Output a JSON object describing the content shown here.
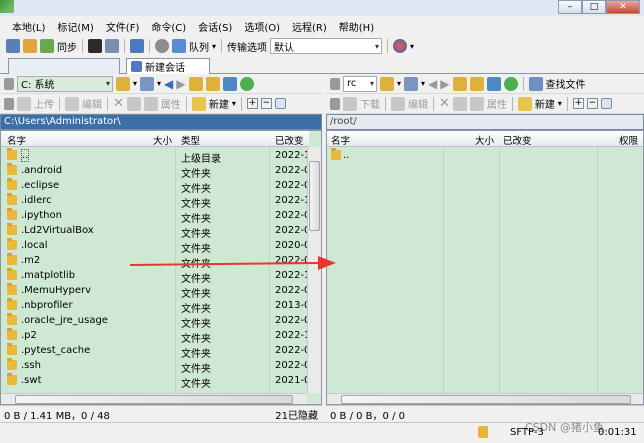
{
  "menu": [
    "本地(L)",
    "标记(M)",
    "文件(F)",
    "命令(C)",
    "会话(S)",
    "选项(O)",
    "远程(R)",
    "帮助(H)"
  ],
  "toolbar": {
    "sync": "同步",
    "queue": "队列",
    "transfer_option": "传输选项",
    "transfer_value": "默认"
  },
  "tabs": {
    "new_session": "新建会话"
  },
  "left": {
    "drive": "C: 系统",
    "actions": {
      "upload": "上传",
      "edit": "编辑",
      "properties": "属性",
      "new": "新建"
    },
    "path": "C:\\Users\\Administrator\\",
    "headers": {
      "name": "名字",
      "size": "大小",
      "type": "类型",
      "changed": "已改变"
    },
    "rows": [
      {
        "name": "..",
        "type": "上级目录",
        "date": "2022-1"
      },
      {
        "name": ".android",
        "type": "文件夹",
        "date": "2022-0"
      },
      {
        "name": ".eclipse",
        "type": "文件夹",
        "date": "2022-0"
      },
      {
        "name": ".idlerc",
        "type": "文件夹",
        "date": "2022-1"
      },
      {
        "name": ".ipython",
        "type": "文件夹",
        "date": "2022-0"
      },
      {
        "name": ".Ld2VirtualBox",
        "type": "文件夹",
        "date": "2022-0"
      },
      {
        "name": ".local",
        "type": "文件夹",
        "date": "2020-0"
      },
      {
        "name": ".m2",
        "type": "文件夹",
        "date": "2022-0"
      },
      {
        "name": ".matplotlib",
        "type": "文件夹",
        "date": "2022-1"
      },
      {
        "name": ".MemuHyperv",
        "type": "文件夹",
        "date": "2022-0"
      },
      {
        "name": ".nbprofiler",
        "type": "文件夹",
        "date": "2013-0"
      },
      {
        "name": ".oracle_jre_usage",
        "type": "文件夹",
        "date": "2022-0"
      },
      {
        "name": ".p2",
        "type": "文件夹",
        "date": "2022-1"
      },
      {
        "name": ".pytest_cache",
        "type": "文件夹",
        "date": "2022-0"
      },
      {
        "name": ".ssh",
        "type": "文件夹",
        "date": "2022-0"
      },
      {
        "name": ".swt",
        "type": "文件夹",
        "date": "2021-0"
      }
    ],
    "status": "0 B / 1.41 MB，0 / 48",
    "hidden": "21已隐藏"
  },
  "right": {
    "drive": "rc",
    "find": "查找文件",
    "actions": {
      "download": "下载",
      "edit": "编辑",
      "properties": "属性",
      "new": "新建"
    },
    "path": "/root/",
    "headers": {
      "name": "名字",
      "size": "大小",
      "changed": "已改变",
      "perm": "权限"
    },
    "rows": [
      {
        "name": ".."
      }
    ],
    "status": "0 B / 0 B，0 / 0"
  },
  "bottom": {
    "protocol": "SFTP-3",
    "time": "0:01:31",
    "watermark": "CSDN @猪小鱼"
  },
  "colors": {
    "list_bg": "#cfe8d4",
    "path_active": "#3c6ea8",
    "arrow": "#e8372c"
  }
}
